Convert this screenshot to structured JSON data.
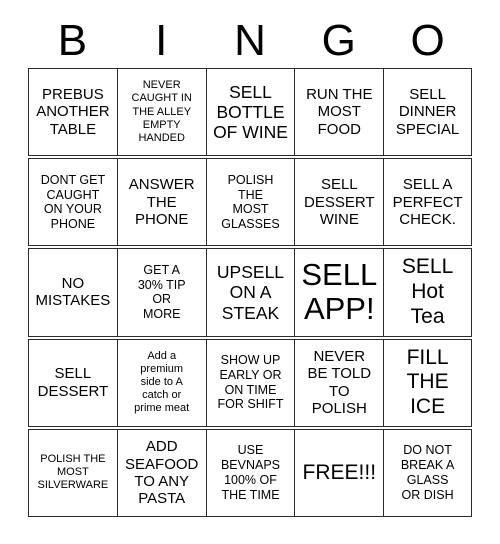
{
  "card": {
    "title": "BINGO",
    "header_letters": [
      "B",
      "I",
      "N",
      "G",
      "O"
    ],
    "rows": 5,
    "columns": 5,
    "border_color": "#2b2b2b",
    "text_color": "#000000",
    "background_color": "#ffffff",
    "free_space_index": 22,
    "free_space_label": "FREE!!!",
    "cells": [
      {
        "text": "PREBUS\nANOTHER\nTABLE",
        "size": "m"
      },
      {
        "text": "NEVER\nCAUGHT IN\nTHE ALLEY\nEMPTY\nHANDED",
        "size": "xs"
      },
      {
        "text": "SELL\nBOTTLE\nOF WINE",
        "size": "l"
      },
      {
        "text": "RUN THE\nMOST\nFOOD",
        "size": "m"
      },
      {
        "text": "SELL\nDINNER\nSPECIAL",
        "size": "m"
      },
      {
        "text": "DONT GET\nCAUGHT\nON YOUR\nPHONE",
        "size": "s"
      },
      {
        "text": "ANSWER\nTHE\nPHONE",
        "size": "m"
      },
      {
        "text": "POLISH\nTHE\nMOST\nGLASSES",
        "size": "s"
      },
      {
        "text": "SELL\nDESSERT\nWINE",
        "size": "m"
      },
      {
        "text": "SELL A\nPERFECT\nCHECK.",
        "size": "m"
      },
      {
        "text": "NO\nMISTAKES",
        "size": "m"
      },
      {
        "text": "GET A\n30% TIP\nOR\nMORE",
        "size": "s"
      },
      {
        "text": "UPSELL\nON A\nSTEAK",
        "size": "l"
      },
      {
        "text": "SELL\nAPP!",
        "size": "xxl"
      },
      {
        "text": "SELL\nHot\nTea",
        "size": "xl"
      },
      {
        "text": "SELL\nDESSERT",
        "size": "m"
      },
      {
        "text": "Add a\npremium\nside to A\ncatch or\nprime meat",
        "size": "xs"
      },
      {
        "text": "SHOW UP\nEARLY OR\nON TIME\nFOR SHIFT",
        "size": "s"
      },
      {
        "text": "NEVER\nBE TOLD\nTO\nPOLISH",
        "size": "m"
      },
      {
        "text": "FILL\nTHE\nICE",
        "size": "xl"
      },
      {
        "text": "POLISH THE\nMOST\nSILVERWARE",
        "size": "xs"
      },
      {
        "text": "ADD\nSEAFOOD\nTO ANY\nPASTA",
        "size": "m"
      },
      {
        "text": "USE\nBEVNAPS\n100% OF\nTHE TIME",
        "size": "s"
      },
      {
        "text": "FREE!!!",
        "size": "xl"
      },
      {
        "text": "DO NOT\nBREAK A\nGLASS\nOR DISH",
        "size": "s"
      }
    ]
  }
}
